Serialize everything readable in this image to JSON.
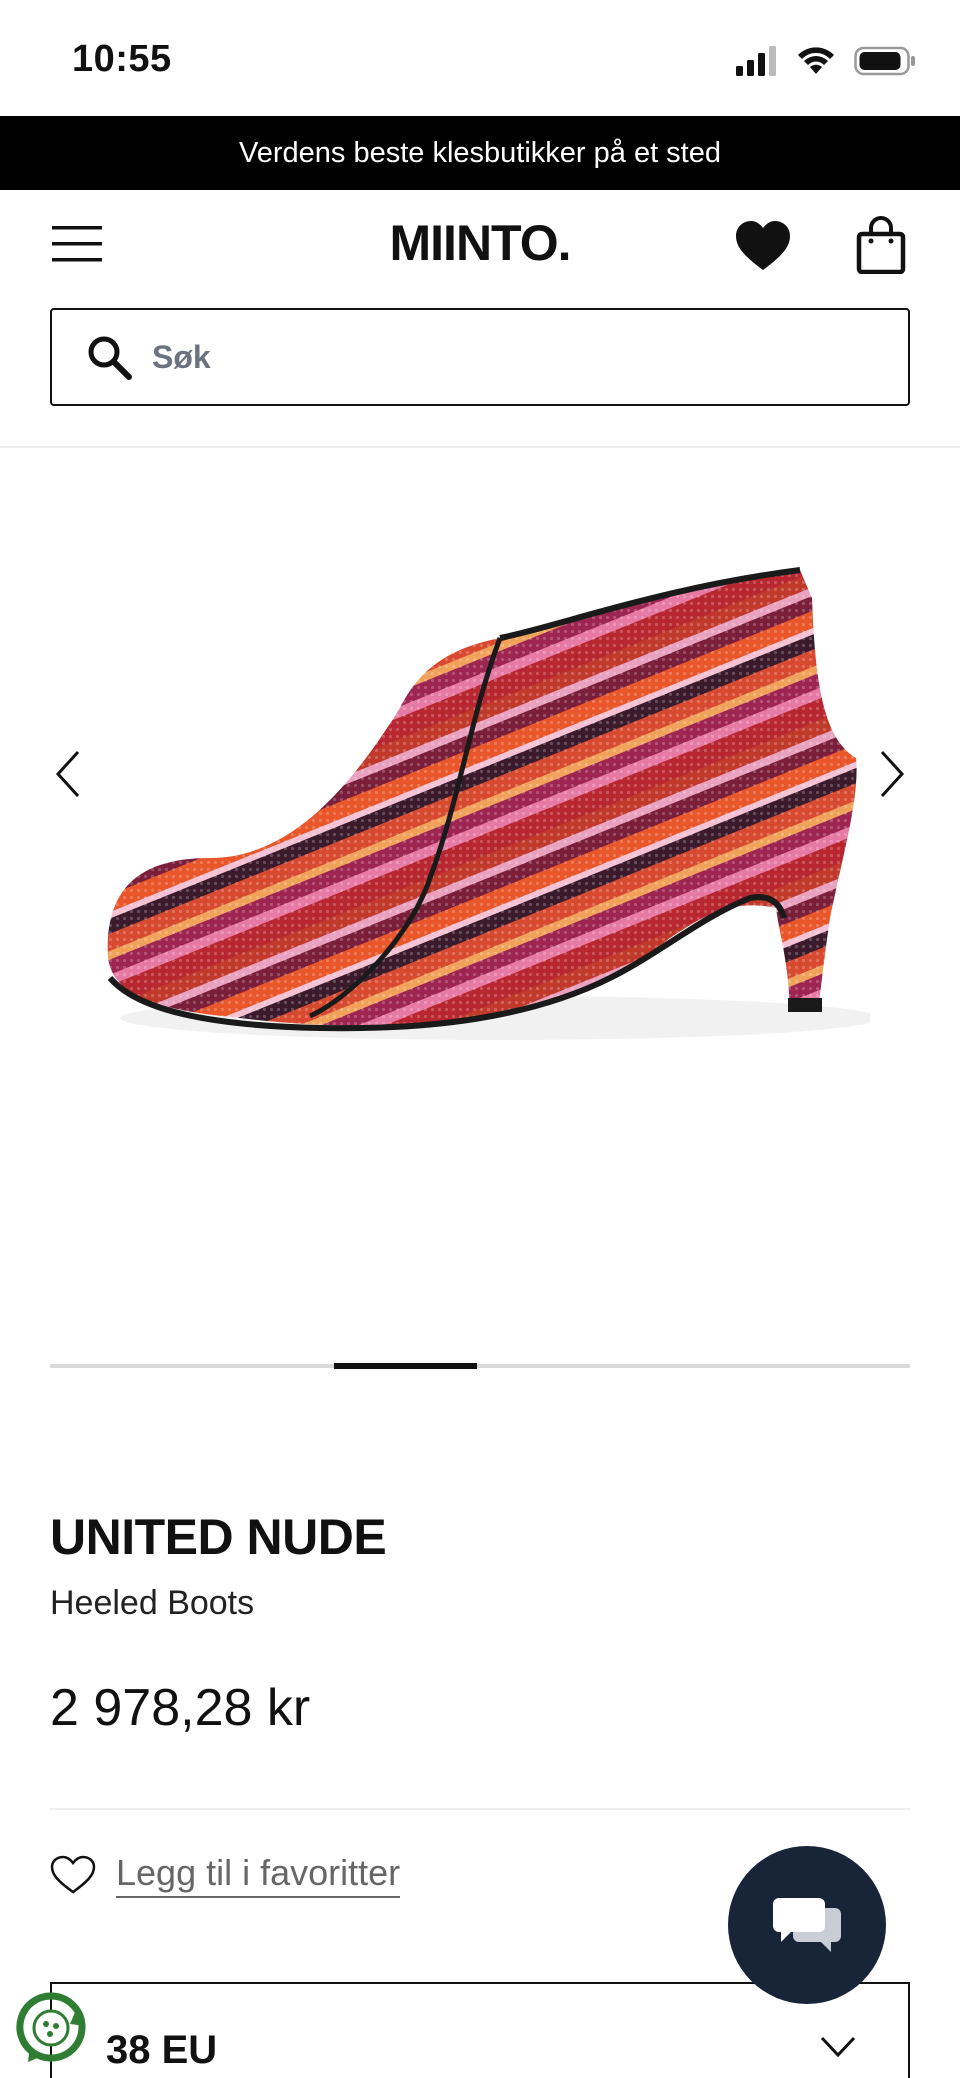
{
  "status_bar": {
    "time": "10:55"
  },
  "promo_banner": {
    "text": "Verdens beste klesbutikker på et sted"
  },
  "header": {
    "logo": "MIINTO."
  },
  "search": {
    "placeholder": "Søk"
  },
  "gallery": {
    "image_index": 3,
    "image_count": 8,
    "position_fraction": 0.33
  },
  "product": {
    "brand": "UNITED NUDE",
    "name": "Heeled Boots",
    "price": "2 978,28 kr"
  },
  "favorites": {
    "label": "Legg til i favoritter"
  },
  "size_selector": {
    "selected": "38 EU"
  },
  "colors": {
    "banner_bg": "#000000",
    "chat_button_bg": "#182437",
    "placeholder_text": "#6b7280",
    "eco_badge": "#2e7d32"
  },
  "icons": [
    "signal-icon",
    "wifi-icon",
    "battery-icon",
    "menu-icon",
    "heart-icon",
    "shopping-bag-icon",
    "search-icon",
    "chevron-left-icon",
    "chevron-right-icon",
    "heart-outline-icon",
    "chat-icon",
    "chevron-down-icon",
    "eco-badge-icon"
  ]
}
